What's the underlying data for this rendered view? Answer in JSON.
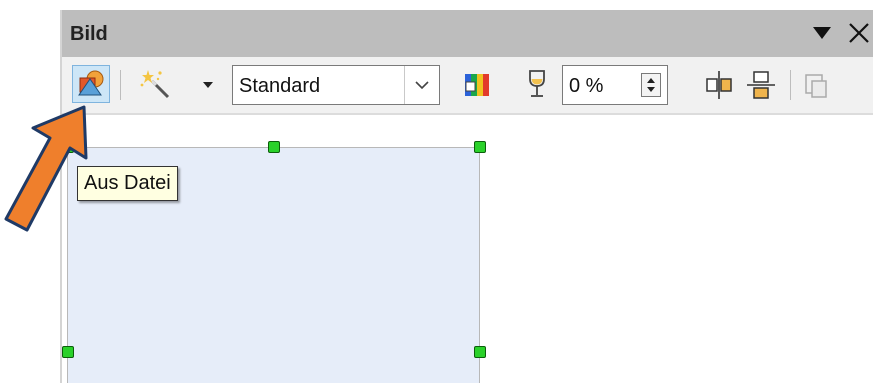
{
  "panel": {
    "title": "Bild"
  },
  "toolbar": {
    "from_file_icon": "image-from-file-icon",
    "filter_icon": "magic-wand-filter-icon",
    "graphics_mode": {
      "selected": "Standard"
    },
    "color_icon": "color-bars-icon",
    "transparency_icon": "wine-glass-transparency-icon",
    "transparency": {
      "value": "0 %"
    },
    "flip_vertical_icon": "flip-vertical-icon",
    "flip_horizontal_icon": "flip-horizontal-icon",
    "crop_icon": "crop-icon"
  },
  "tooltip": {
    "text": "Aus Datei"
  },
  "colors": {
    "selection_handle": "#2ad12a",
    "frame_fill": "#e6edf9",
    "arrow": "#ef7f2c"
  }
}
